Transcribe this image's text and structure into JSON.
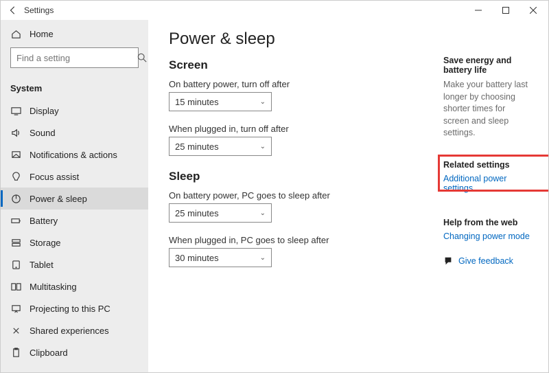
{
  "window": {
    "title": "Settings"
  },
  "sidebar": {
    "home": "Home",
    "search_placeholder": "Find a setting",
    "section": "System",
    "items": [
      {
        "label": "Display"
      },
      {
        "label": "Sound"
      },
      {
        "label": "Notifications & actions"
      },
      {
        "label": "Focus assist"
      },
      {
        "label": "Power & sleep"
      },
      {
        "label": "Battery"
      },
      {
        "label": "Storage"
      },
      {
        "label": "Tablet"
      },
      {
        "label": "Multitasking"
      },
      {
        "label": "Projecting to this PC"
      },
      {
        "label": "Shared experiences"
      },
      {
        "label": "Clipboard"
      }
    ]
  },
  "main": {
    "heading": "Power & sleep",
    "screen": {
      "heading": "Screen",
      "battery_label": "On battery power, turn off after",
      "battery_value": "15 minutes",
      "plugged_label": "When plugged in, turn off after",
      "plugged_value": "25 minutes"
    },
    "sleep": {
      "heading": "Sleep",
      "battery_label": "On battery power, PC goes to sleep after",
      "battery_value": "25 minutes",
      "plugged_label": "When plugged in, PC goes to sleep after",
      "plugged_value": "30 minutes"
    }
  },
  "aside": {
    "energy_head": "Save energy and battery life",
    "energy_body": "Make your battery last longer by choosing shorter times for screen and sleep settings.",
    "related_head": "Related settings",
    "related_link": "Additional power settings",
    "help_head": "Help from the web",
    "help_link": "Changing power mode",
    "feedback": "Give feedback"
  }
}
